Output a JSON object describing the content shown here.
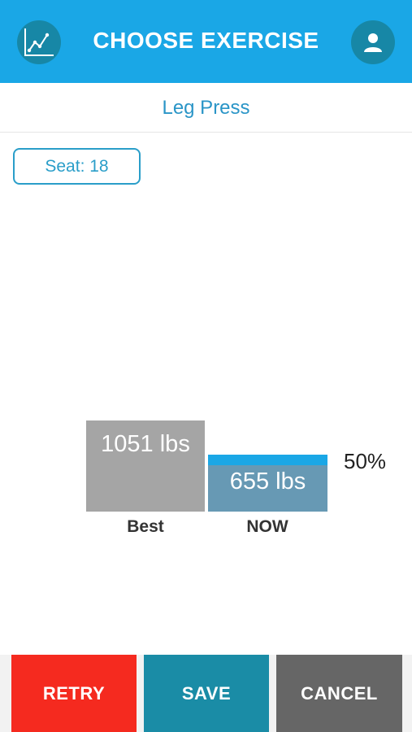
{
  "header": {
    "title": "CHOOSE EXERCISE",
    "left_icon": "chart-line-icon",
    "right_icon": "user-icon",
    "bg_color": "#1aa7e6"
  },
  "exercise": {
    "name": "Leg Press",
    "seat_label": "Seat: 18"
  },
  "chart_data": {
    "type": "bar",
    "categories": [
      "Best",
      "NOW"
    ],
    "values": [
      1051,
      655
    ],
    "value_labels": [
      "1051 lbs",
      "655 lbs"
    ],
    "unit": "lbs",
    "percent_label": "50%",
    "percent_value": 0.5,
    "colors": {
      "best": "#a5a5a5",
      "now": "#6799b4",
      "progress": "#1aa7e6"
    }
  },
  "footer": {
    "retry_label": "RETRY",
    "save_label": "SAVE",
    "cancel_label": "CANCEL",
    "colors": {
      "retry": "#f52a1f",
      "save": "#1a8ca6",
      "cancel": "#666666"
    }
  }
}
